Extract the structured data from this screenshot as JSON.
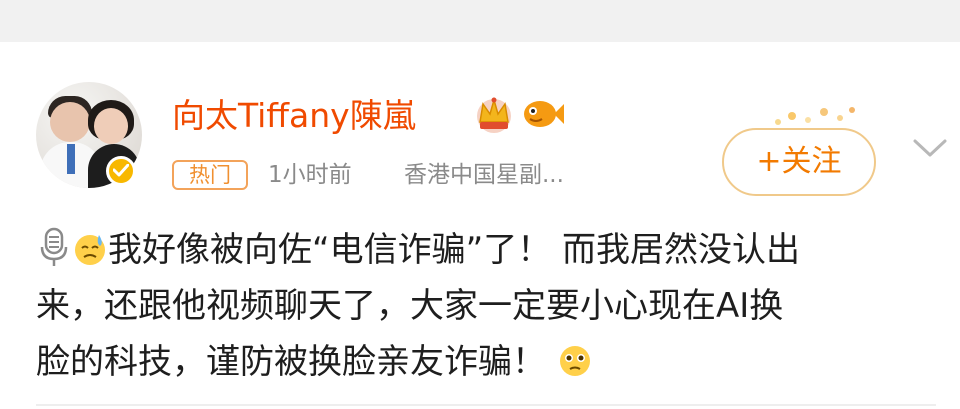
{
  "post": {
    "author": {
      "name": "向太Tiffany陳嵐",
      "verified": true,
      "name_color": "#f04a00"
    },
    "meta": {
      "badge": "热门",
      "time": "1小时前",
      "source": "香港中国星副..."
    },
    "follow_label": "+关注",
    "body_lines": [
      "我好像被向佐“电信诈骗”了！ 而我居然没认出",
      "来，还跟他视频聊天了，大家一定要小心现在AI换",
      "脸的科技，谨防被换脸亲友诈骗！"
    ],
    "icons": {
      "mic": "microphone-icon",
      "sweat_emoji": "sweat-emoji-icon",
      "pleading_emoji": "pleading-emoji-icon",
      "crown": "crown-icon",
      "fish": "fish-icon",
      "chevron": "chevron-down-icon"
    },
    "accent_color": "#f27a00"
  }
}
